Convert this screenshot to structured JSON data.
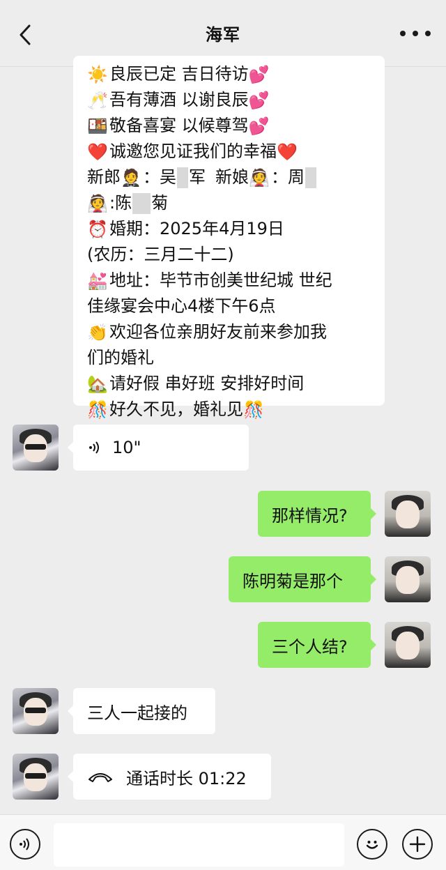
{
  "header": {
    "title": "海军"
  },
  "invitation": {
    "lines": [
      {
        "emoji": "☀️",
        "text": "良辰已定 吉日待访",
        "emoji_end": "💕"
      },
      {
        "emoji": "🥂",
        "text": "吾有薄酒 以谢良辰",
        "emoji_end": "💕"
      },
      {
        "emoji": "🍱",
        "text": "敬备喜宴 以候尊驾",
        "emoji_end": "💕"
      },
      {
        "emoji": "❤️",
        "text": "诚邀您见证我们的幸福",
        "emoji_end": "❤️"
      },
      {
        "label_groom": "新郎",
        "emoji_groom": "🤵",
        "groom_a": "：吴",
        "groom_b": "军",
        "label_bride": "新娘",
        "emoji_bride": "👰",
        "bride_a": "：周"
      },
      {
        "emoji": "👰",
        "text_a": ":陈",
        "text_b": "菊"
      },
      {
        "emoji": "⏰",
        "text": "婚期：2025年4月19日"
      },
      {
        "text": "(农历：三月二十二)"
      },
      {
        "emoji": "💒",
        "text": "地址：毕节市创美世纪城 世纪"
      },
      {
        "text": "佳缘宴会中心4楼下午6点"
      },
      {
        "emoji": "👏",
        "text": "欢迎各位亲朋好友前来参加我"
      },
      {
        "text": "们的婚礼"
      },
      {
        "emoji": "🏡",
        "text": "请好假 串好班 安排好时间"
      },
      {
        "emoji": "🎊",
        "text": "好久不见，婚礼见",
        "emoji_end": "🎊"
      }
    ]
  },
  "messages": {
    "voice": {
      "icon": "voice-icon",
      "duration": "10\""
    },
    "m1": "那样情况?",
    "m2": "陈明菊是那个",
    "m3": "三个人结?",
    "m4": "三人一起接的",
    "call": {
      "icon": "phone-icon",
      "text": "通话时长 01:22"
    }
  },
  "colors": {
    "sent_bubble": "#95ec69",
    "received_bubble": "#ffffff",
    "background": "#ededed"
  }
}
